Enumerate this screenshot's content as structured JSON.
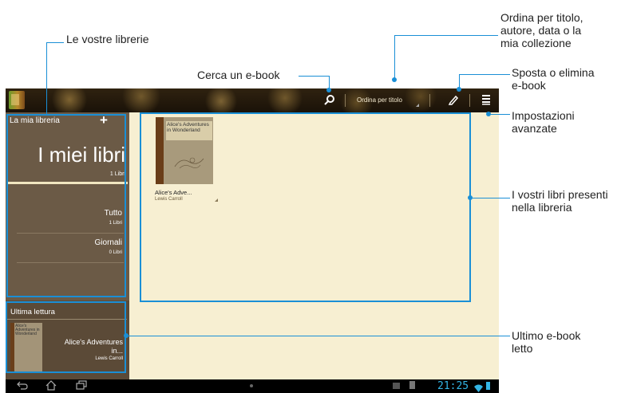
{
  "callouts": {
    "libraries": "Le vostre librerie",
    "search": "Cerca un e-book",
    "sort": [
      "Ordina per titolo,",
      "autore, data o la",
      "mia collezione"
    ],
    "move_delete": [
      "Sposta o elimina",
      "e-book"
    ],
    "advanced": [
      "Impostazioni",
      "avanzate"
    ],
    "your_books": [
      "I vostri libri presenti",
      "nella libreria"
    ],
    "last_read": [
      "Ultimo e-book",
      "letto"
    ]
  },
  "topbar": {
    "sort_label": "Ordina per titolo"
  },
  "sidebar": {
    "library_title": "La mia libreria",
    "plus": "+",
    "my_books": "I miei libri",
    "my_books_count": "1 Libri",
    "items": [
      {
        "label": "Tutto",
        "count": "1 Libri"
      },
      {
        "label": "Giornali",
        "count": "0 Libri"
      }
    ],
    "recent_label": "Ultima lettura",
    "recent_book": {
      "cover_title": "Alice's Adventures in Wonderland",
      "title": "Alice's Adventures in...",
      "author": "Lewis Carroll"
    }
  },
  "books": [
    {
      "cover_title": "Alice's Adventures in Wonderland",
      "title": "Alice's Adve...",
      "author": "Lewis Carroll"
    }
  ],
  "statusbar": {
    "time": "21:25"
  },
  "icons": [
    "search-icon",
    "pencil-icon",
    "menu-icon",
    "back-icon",
    "home-icon",
    "recent-apps-icon",
    "wifi-icon",
    "battery-icon"
  ],
  "colors": {
    "callout_blue": "#1a8fd6",
    "sidebar_brown": "#6b5a46",
    "content_cream": "#f7efd2",
    "clock_blue": "#33b5e5"
  }
}
